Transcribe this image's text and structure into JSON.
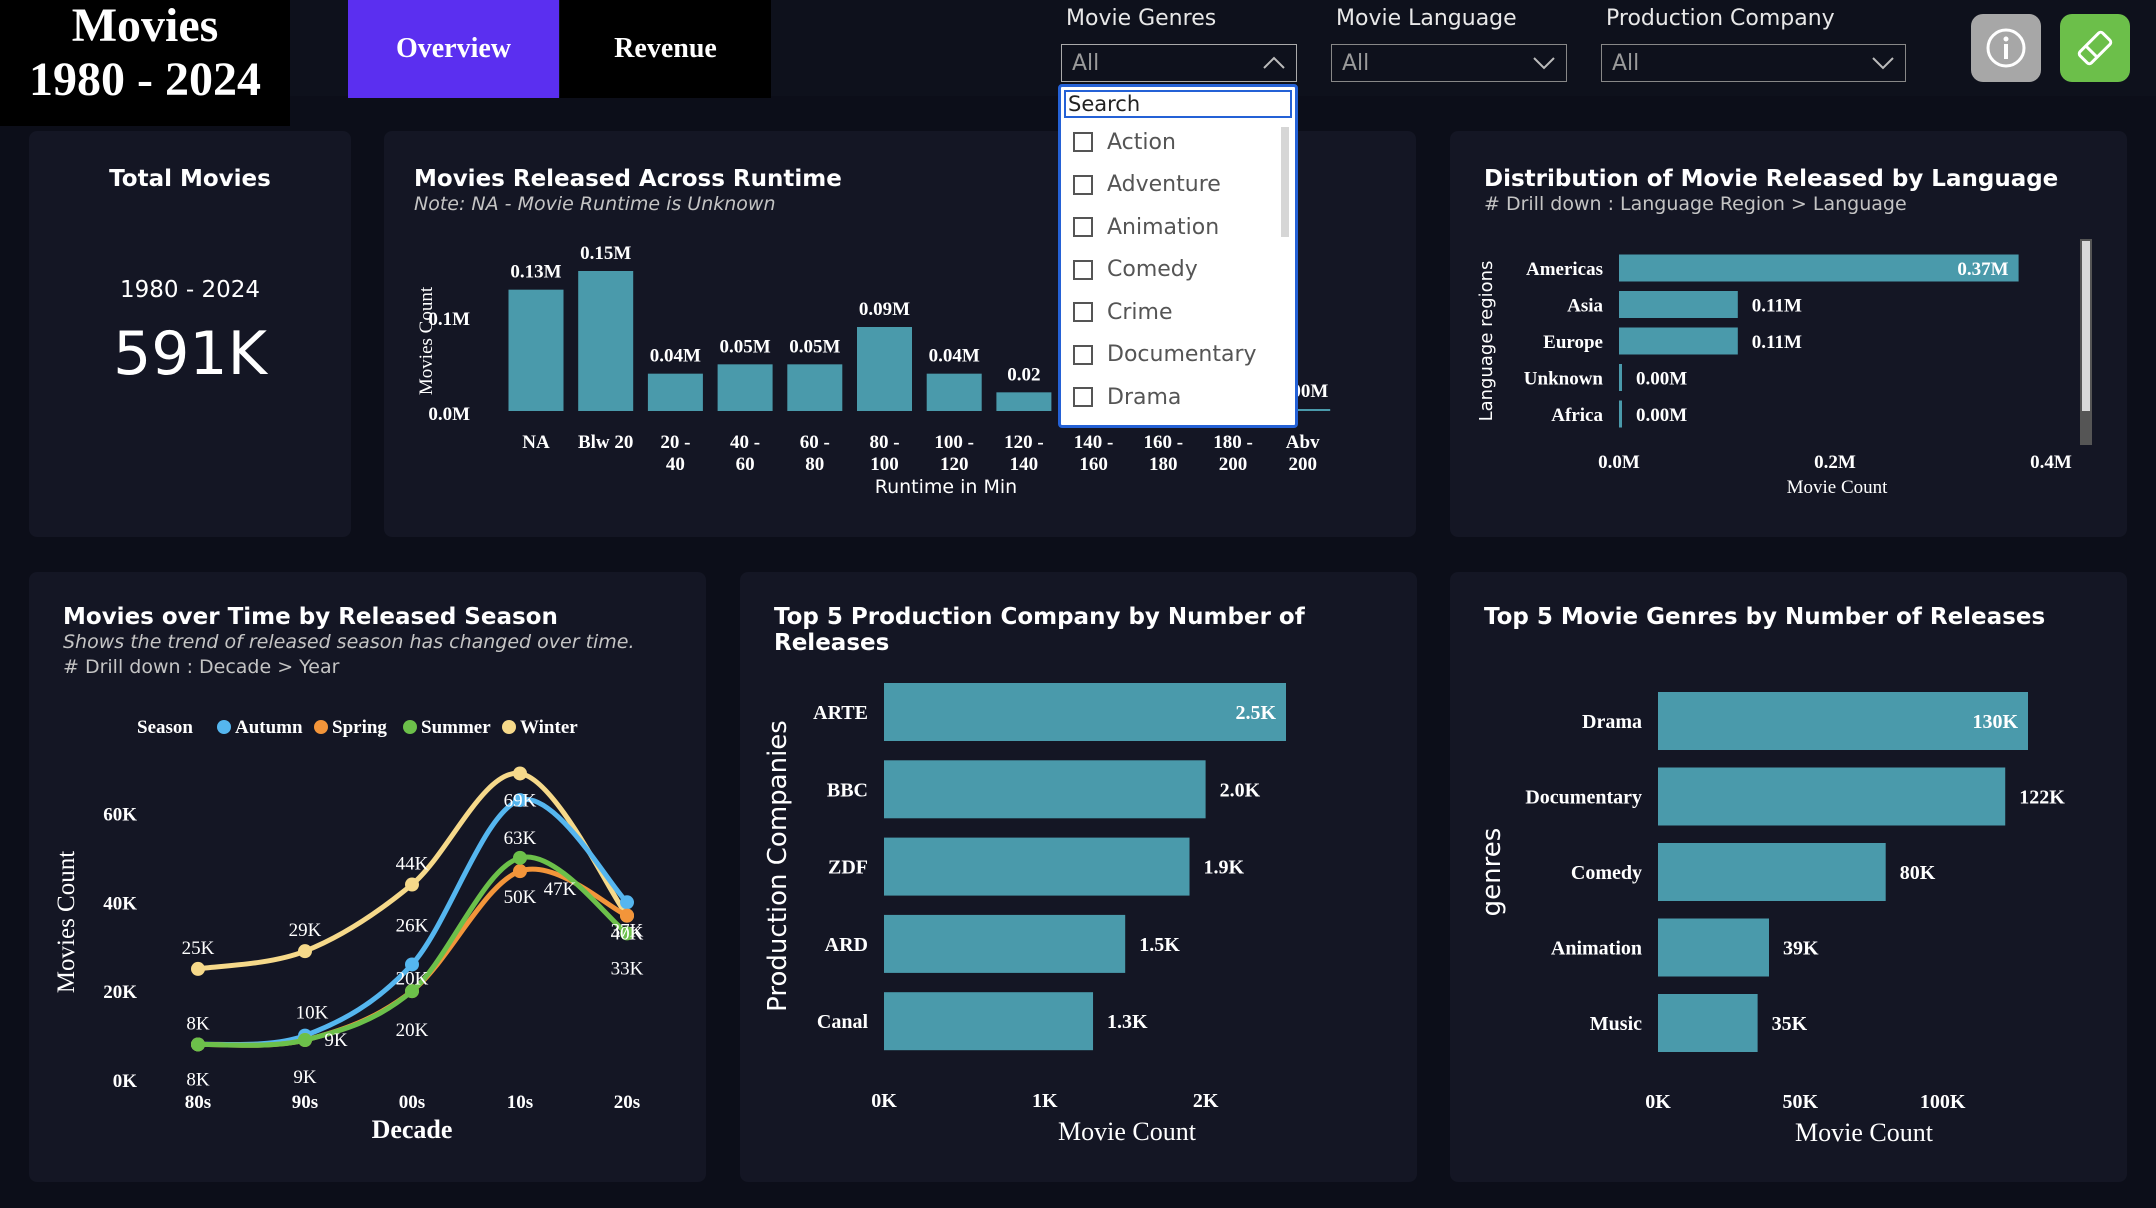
{
  "header": {
    "title_line1": "Movies",
    "title_line2": "1980 - 2024",
    "tabs": [
      {
        "label": "Overview",
        "active": true
      },
      {
        "label": "Revenue",
        "active": false
      }
    ]
  },
  "filters": [
    {
      "label": "Movie Genres",
      "value": "All"
    },
    {
      "label": "Movie Language",
      "value": "All"
    },
    {
      "label": "Production Company",
      "value": "All"
    }
  ],
  "genre_dropdown": {
    "placeholder": "Search",
    "options": [
      "Action",
      "Adventure",
      "Animation",
      "Comedy",
      "Crime",
      "Documentary",
      "Drama"
    ]
  },
  "buttons": {
    "info_icon": "info-icon",
    "eraser_icon": "eraser-icon"
  },
  "colors": {
    "accent": "#5b2ff0",
    "bar": "#4a9aab",
    "autumn": "#55b6ef",
    "spring": "#f3953a",
    "summer": "#6cc04a",
    "winter": "#f6d98a",
    "eraser_bg": "#6cbf4a",
    "info_bg": "#a7a7a7"
  },
  "total_card": {
    "title": "Total Movies",
    "range": "1980 - 2024",
    "value": "591K"
  },
  "runtime_card": {
    "title": "Movies Released Across Runtime",
    "subtitle": "Note: NA - Movie Runtime is Unknown"
  },
  "language_card": {
    "title": "Distribution of Movie Released by Language",
    "subtitle": "# Drill down : Language Region > Language"
  },
  "season_card": {
    "title": "Movies over Time by Released Season",
    "subtitle": "Shows the trend of released season has changed over time.",
    "subtitle2": "# Drill down : Decade > Year"
  },
  "production_card": {
    "title": "Top 5 Production Company by Number of Releases"
  },
  "genres_card": {
    "title": "Top 5 Movie Genres by Number of Releases"
  },
  "chart_data": [
    {
      "id": "runtime",
      "type": "bar",
      "categories": [
        "NA",
        "Blw 20",
        "20 - 40",
        "40 - 60",
        "60 - 80",
        "80 - 100",
        "100 - 120",
        "120 - 140",
        "140 - 160",
        "160 - 180",
        "180 - 200",
        "Abv 200"
      ],
      "values": [
        0.13,
        0.15,
        0.04,
        0.05,
        0.05,
        0.09,
        0.04,
        0.02,
        0.01,
        0.01,
        0.0,
        0.0
      ],
      "data_labels": [
        "0.13M",
        "0.15M",
        "0.04M",
        "0.05M",
        "0.05M",
        "0.09M",
        "0.04M",
        "0.02",
        "",
        "",
        "",
        "0.00M"
      ],
      "xlabel": "Runtime in Min",
      "ylabel": "Movies Count",
      "yticks": [
        "0.0M",
        "0.1M"
      ],
      "ylim": [
        0,
        0.15
      ]
    },
    {
      "id": "language",
      "type": "bar",
      "orientation": "horizontal",
      "categories": [
        "Americas",
        "Asia",
        "Europe",
        "Unknown",
        "Africa"
      ],
      "values": [
        0.37,
        0.11,
        0.11,
        0.0,
        0.0
      ],
      "data_labels": [
        "0.37M",
        "0.11M",
        "0.11M",
        "0.00M",
        "0.00M"
      ],
      "xlabel": "Movie Count",
      "ylabel": "Language regions",
      "xticks": [
        "0.0M",
        "0.2M",
        "0.4M"
      ],
      "xlim": [
        0,
        0.4
      ]
    },
    {
      "id": "season",
      "type": "line",
      "x": [
        "80s",
        "90s",
        "00s",
        "10s",
        "20s"
      ],
      "legend_title": "Season",
      "series": [
        {
          "name": "Autumn",
          "values": [
            8,
            10,
            26,
            63,
            40
          ],
          "labels": [
            "8K",
            "10K",
            "26K",
            "63K",
            "40K"
          ]
        },
        {
          "name": "Spring",
          "values": [
            8,
            9,
            20,
            47,
            37
          ],
          "labels": [
            "",
            "",
            "",
            "47K",
            "37K"
          ]
        },
        {
          "name": "Summer",
          "values": [
            8,
            9,
            20,
            50,
            33
          ],
          "labels": [
            "8K",
            "9K",
            "20K",
            "50K",
            "33K"
          ]
        },
        {
          "name": "Winter",
          "values": [
            25,
            29,
            44,
            69,
            37
          ],
          "labels": [
            "25K",
            "29K",
            "44K",
            "69K",
            ""
          ]
        }
      ],
      "extra_labels": [
        "20K",
        "9K"
      ],
      "xlabel": "Decade",
      "ylabel": "Movies Count",
      "yticks": [
        "0K",
        "20K",
        "40K",
        "60K"
      ],
      "ylim": [
        0,
        70
      ]
    },
    {
      "id": "production",
      "type": "bar",
      "orientation": "horizontal",
      "categories": [
        "ARTE",
        "BBC",
        "ZDF",
        "ARD",
        "Canal"
      ],
      "values": [
        2.5,
        2.0,
        1.9,
        1.5,
        1.3
      ],
      "data_labels": [
        "2.5K",
        "2.0K",
        "1.9K",
        "1.5K",
        "1.3K"
      ],
      "xlabel": "Movie Count",
      "ylabel": "Production Companies",
      "xticks": [
        "0K",
        "1K",
        "2K"
      ],
      "xlim": [
        0,
        2.5
      ]
    },
    {
      "id": "genres",
      "type": "bar",
      "orientation": "horizontal",
      "categories": [
        "Drama",
        "Documentary",
        "Comedy",
        "Animation",
        "Music"
      ],
      "values": [
        130,
        122,
        80,
        39,
        35
      ],
      "data_labels": [
        "130K",
        "122K",
        "80K",
        "39K",
        "35K"
      ],
      "xlabel": "Movie Count",
      "ylabel": "genres",
      "xticks": [
        "0K",
        "50K",
        "100K"
      ],
      "xlim": [
        0,
        130
      ]
    }
  ]
}
